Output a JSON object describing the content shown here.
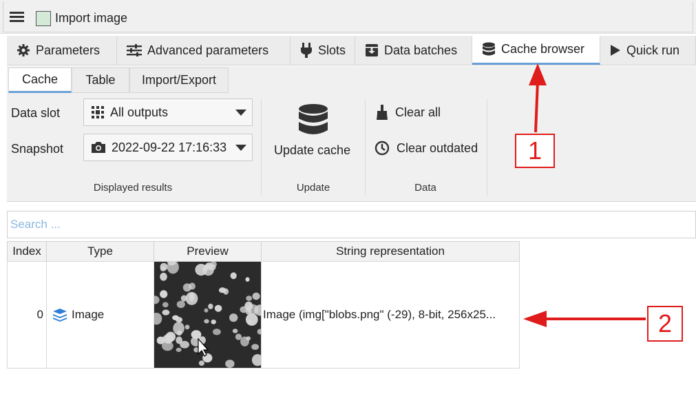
{
  "node": {
    "title": "Import image",
    "swatch_color": "#d4ead8"
  },
  "tabs": [
    {
      "label": "Parameters",
      "icon": "gear-icon"
    },
    {
      "label": "Advanced parameters",
      "icon": "sliders-icon"
    },
    {
      "label": "Slots",
      "icon": "plug-icon"
    },
    {
      "label": "Data batches",
      "icon": "archive-box-icon"
    },
    {
      "label": "Cache browser",
      "icon": "database-icon",
      "active": true
    },
    {
      "label": "Quick run",
      "icon": "play-icon"
    }
  ],
  "subtabs": [
    {
      "label": "Cache",
      "active": true
    },
    {
      "label": "Table"
    },
    {
      "label": "Import/Export"
    }
  ],
  "ribbon": {
    "data_slot_label": "Data slot",
    "data_slot_value": "All outputs",
    "snapshot_label": "Snapshot",
    "snapshot_value": "2022-09-22 17:16:33",
    "displayed_results_label": "Displayed results",
    "update_cache_label": "Update cache",
    "update_group_label": "Update",
    "clear_all_label": "Clear all",
    "clear_outdated_label": "Clear outdated",
    "data_group_label": "Data"
  },
  "search": {
    "placeholder": "Search ..."
  },
  "table": {
    "headers": [
      "Index",
      "Type",
      "Preview",
      "String representation"
    ],
    "rows": [
      {
        "index": "0",
        "type": "Image",
        "string_repr": "Image (img[\"blobs.png\" (-29), 8-bit, 256x25..."
      }
    ]
  },
  "annotations": {
    "callout_1": "1",
    "callout_2": "2",
    "color": "#e01b1b"
  },
  "accent_color": "#6aa0d8"
}
